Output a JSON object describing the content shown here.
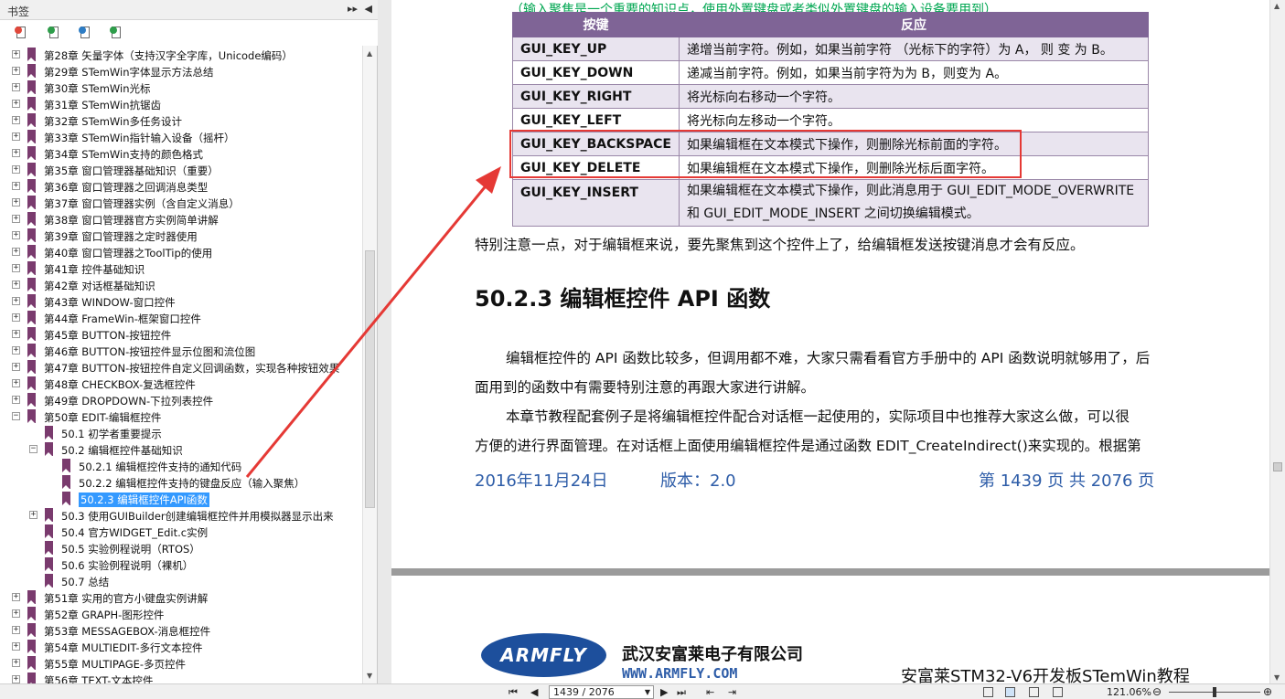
{
  "bookmarks_panel": {
    "title": "书签",
    "collapse_icon": "double-chevron-right",
    "close_icon": "triangle-left",
    "toolbar_icons": [
      "bookmark-delete-icon",
      "bookmark-add-icon",
      "bookmark-expand-icon",
      "bookmark-properties-icon"
    ],
    "items": [
      {
        "label": "第28章 矢量字体（支持汉字全字库，Unicode编码）",
        "level": 0,
        "expander": "+"
      },
      {
        "label": "第29章 STemWin字体显示方法总结",
        "level": 0,
        "expander": "+"
      },
      {
        "label": "第30章 STemWin光标",
        "level": 0,
        "expander": "+"
      },
      {
        "label": "第31章 STemWin抗锯齿",
        "level": 0,
        "expander": "+"
      },
      {
        "label": "第32章 STemWin多任务设计",
        "level": 0,
        "expander": "+"
      },
      {
        "label": "第33章 STemWin指针输入设备（摇杆）",
        "level": 0,
        "expander": "+"
      },
      {
        "label": "第34章 STemWin支持的颜色格式",
        "level": 0,
        "expander": "+"
      },
      {
        "label": "第35章 窗口管理器基础知识（重要）",
        "level": 0,
        "expander": "+"
      },
      {
        "label": "第36章 窗口管理器之回调消息类型",
        "level": 0,
        "expander": "+"
      },
      {
        "label": "第37章 窗口管理器实例（含自定义消息）",
        "level": 0,
        "expander": "+"
      },
      {
        "label": "第38章 窗口管理器官方实例简单讲解",
        "level": 0,
        "expander": "+"
      },
      {
        "label": "第39章 窗口管理器之定时器使用",
        "level": 0,
        "expander": "+"
      },
      {
        "label": "第40章 窗口管理器之ToolTip的使用",
        "level": 0,
        "expander": "+"
      },
      {
        "label": "第41章 控件基础知识",
        "level": 0,
        "expander": "+"
      },
      {
        "label": "第42章 对话框基础知识",
        "level": 0,
        "expander": "+"
      },
      {
        "label": "第43章 WINDOW-窗口控件",
        "level": 0,
        "expander": "+"
      },
      {
        "label": "第44章 FrameWin-框架窗口控件",
        "level": 0,
        "expander": "+"
      },
      {
        "label": "第45章 BUTTON-按钮控件",
        "level": 0,
        "expander": "+"
      },
      {
        "label": "第46章 BUTTON-按钮控件显示位图和流位图",
        "level": 0,
        "expander": "+"
      },
      {
        "label": "第47章 BUTTON-按钮控件自定义回调函数，实现各种按钮效果",
        "level": 0,
        "expander": "+"
      },
      {
        "label": "第48章 CHECKBOX-复选框控件",
        "level": 0,
        "expander": "+"
      },
      {
        "label": "第49章 DROPDOWN-下拉列表控件",
        "level": 0,
        "expander": "+"
      },
      {
        "label": "第50章 EDIT-编辑框控件",
        "level": 0,
        "expander": "−"
      },
      {
        "label": "50.1 初学者重要提示",
        "level": 1,
        "expander": ""
      },
      {
        "label": "50.2 编辑框控件基础知识",
        "level": 1,
        "expander": "−"
      },
      {
        "label": "50.2.1 编辑框控件支持的通知代码",
        "level": 2,
        "expander": ""
      },
      {
        "label": "50.2.2 编辑框控件支持的键盘反应（输入聚焦）",
        "level": 2,
        "expander": ""
      },
      {
        "label": "50.2.3 编辑框控件API函数",
        "level": 2,
        "expander": "",
        "selected": true
      },
      {
        "label": "50.3 使用GUIBuilder创建编辑框控件并用模拟器显示出来",
        "level": 1,
        "expander": "+"
      },
      {
        "label": "50.4 官方WIDGET_Edit.c实例",
        "level": 1,
        "expander": ""
      },
      {
        "label": "50.5 实验例程说明（RTOS）",
        "level": 1,
        "expander": ""
      },
      {
        "label": "50.6 实验例程说明（裸机）",
        "level": 1,
        "expander": ""
      },
      {
        "label": "50.7 总结",
        "level": 1,
        "expander": ""
      },
      {
        "label": "第51章 实用的官方小键盘实例讲解",
        "level": 0,
        "expander": "+"
      },
      {
        "label": "第52章 GRAPH-图形控件",
        "level": 0,
        "expander": "+"
      },
      {
        "label": "第53章 MESSAGEBOX-消息框控件",
        "level": 0,
        "expander": "+"
      },
      {
        "label": "第54章 MULTIEDIT-多行文本控件",
        "level": 0,
        "expander": "+"
      },
      {
        "label": "第55章 MULTIPAGE-多页控件",
        "level": 0,
        "expander": "+"
      },
      {
        "label": "第56章 TEXT-文本控件",
        "level": 0,
        "expander": "+"
      }
    ]
  },
  "document": {
    "intro_line": "（输入聚焦是一个重要的知识点，使用外置键盘或者类似外置键盘的输入设备要用到）",
    "table": {
      "headers": [
        "按键",
        "反应"
      ],
      "rows": [
        {
          "key": "GUI_KEY_UP",
          "desc": "递增当前字符。例如，如果当前字符 （光标下的字符）为 A， 则 变 为 B。"
        },
        {
          "key": "GUI_KEY_DOWN",
          "desc": "递减当前字符。例如，如果当前字符为为 B，则变为 A。"
        },
        {
          "key": "GUI_KEY_RIGHT",
          "desc": "将光标向右移动一个字符。"
        },
        {
          "key": "GUI_KEY_LEFT",
          "desc": "将光标向左移动一个字符。"
        },
        {
          "key": "GUI_KEY_BACKSPACE",
          "desc": "如果编辑框在文本模式下操作，则删除光标前面的字符。"
        },
        {
          "key": "GUI_KEY_DELETE",
          "desc": "如果编辑框在文本模式下操作，则删除光标后面字符。"
        },
        {
          "key": "GUI_KEY_INSERT",
          "desc": "如果编辑框在文本模式下操作，则此消息用于 GUI_EDIT_MODE_OVERWRITE",
          "desc2": "和 GUI_EDIT_MODE_INSERT 之间切换编辑模式。"
        }
      ]
    },
    "note": "特别注意一点，对于编辑框来说，要先聚焦到这个控件上了，给编辑框发送按键消息才会有反应。",
    "heading": "50.2.3 编辑框控件 API 函数",
    "para1_line1": "编辑框控件的 API 函数比较多，但调用都不难，大家只需看看官方手册中的 API 函数说明就够用了，后",
    "para1_line2": "面用到的函数中有需要特别注意的再跟大家进行讲解。",
    "para2_line1": "本章节教程配套例子是将编辑框控件配合对话框一起使用的，实际项目中也推荐大家这么做，可以很",
    "para2_line2": "方便的进行界面管理。在对话框上面使用编辑框控件是通过函数 EDIT_CreateIndirect()来实现的。根据第",
    "footer": {
      "date": "2016年11月24日",
      "version": "版本：2.0",
      "page": "第 1439 页  共 2076 页"
    },
    "page2": {
      "logo": "ARMFLY",
      "company": "武汉安富莱电子有限公司",
      "url": "WWW.ARMFLY.COM",
      "title": "安富莱STM32-V6开发板STemWin教程"
    }
  },
  "status_bar": {
    "page_field": "1439 / 2076",
    "zoom": "121.06%"
  },
  "colors": {
    "table_header": "#7f6496",
    "highlight": "#e53935",
    "footer_text": "#2e5da8",
    "selected_bookmark": "#3399ff"
  }
}
